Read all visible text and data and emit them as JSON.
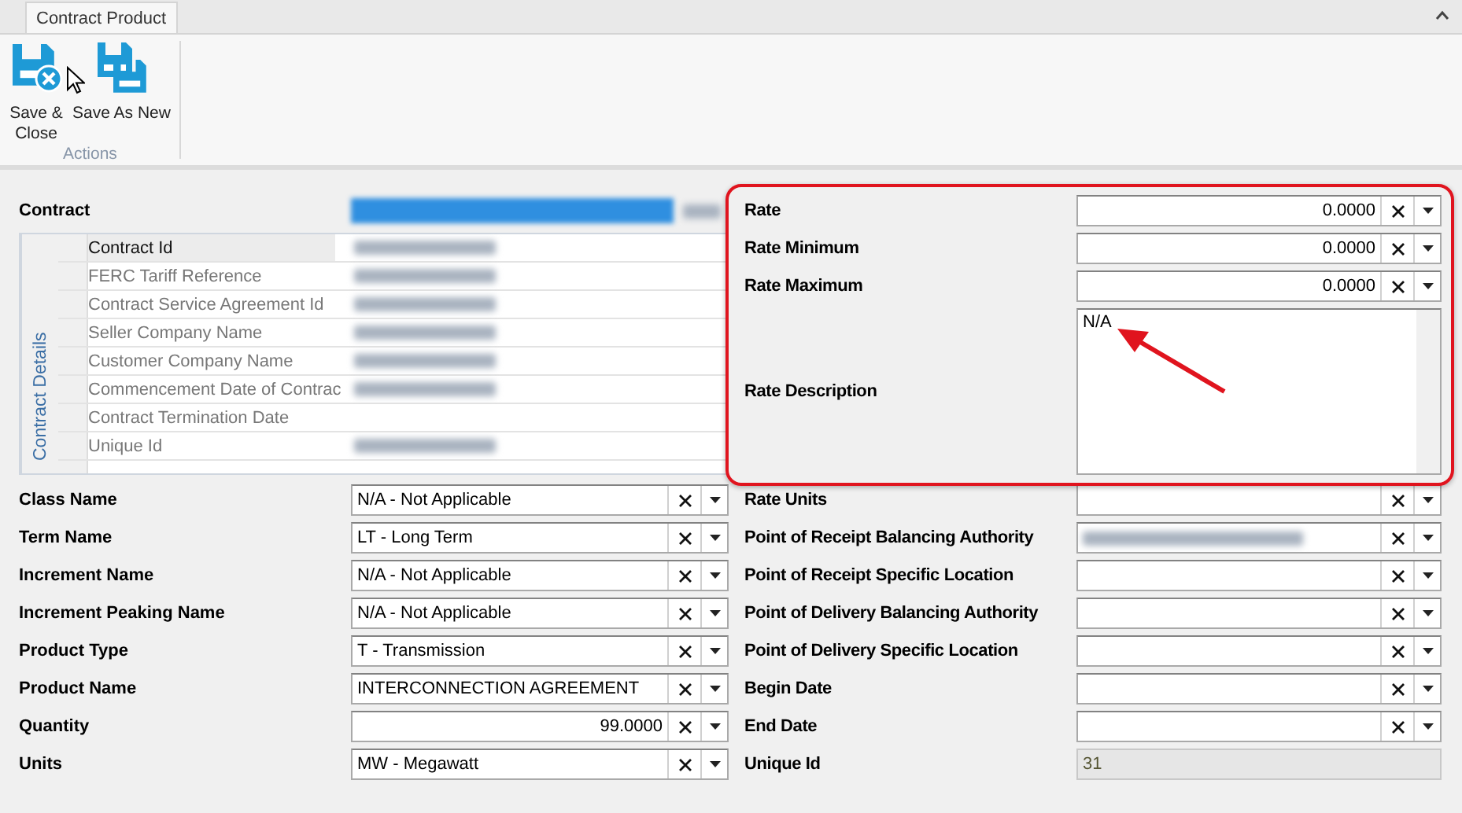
{
  "tabs": [
    {
      "label": "Contract Product",
      "selected": true
    }
  ],
  "ribbon": {
    "groups": [
      {
        "label": "Actions",
        "buttons": [
          {
            "kind": "save-close",
            "label": "Save &\nClose"
          },
          {
            "kind": "save-new",
            "label": "Save As New"
          }
        ]
      }
    ]
  },
  "contract": {
    "label": "Contract",
    "kind": "blurred-combo"
  },
  "contract_details": {
    "title": "Contract Details",
    "rows": [
      {
        "label": "Contract Id",
        "selected": true,
        "blurred": true
      },
      {
        "label": "FERC Tariff Reference",
        "selected": false,
        "blurred": true
      },
      {
        "label": "Contract Service Agreement Id",
        "selected": false,
        "blurred": true
      },
      {
        "label": "Seller Company Name",
        "selected": false,
        "blurred": true
      },
      {
        "label": "Customer Company Name",
        "selected": false,
        "blurred": true
      },
      {
        "label": "Commencement Date of Contrac",
        "selected": false,
        "blurred": true
      },
      {
        "label": "Contract Termination Date",
        "selected": false,
        "blurred": false
      },
      {
        "label": "Unique Id",
        "selected": false,
        "blurred": true
      }
    ]
  },
  "left_fields": [
    {
      "label": "Class Name",
      "kind": "combo",
      "value": "N/A - Not Applicable"
    },
    {
      "label": "Term Name",
      "kind": "combo",
      "value": "LT - Long Term"
    },
    {
      "label": "Increment Name",
      "kind": "combo",
      "value": "N/A - Not Applicable"
    },
    {
      "label": "Increment Peaking Name",
      "kind": "combo",
      "value": "N/A - Not Applicable"
    },
    {
      "label": "Product Type",
      "kind": "combo",
      "value": "T - Transmission"
    },
    {
      "label": "Product Name",
      "kind": "combo",
      "value": "INTERCONNECTION AGREEMENT"
    },
    {
      "label": "Quantity",
      "kind": "number",
      "value": "99.0000"
    },
    {
      "label": "Units",
      "kind": "combo",
      "value": "MW - Megawatt"
    }
  ],
  "rate_fields": [
    {
      "label": "Rate",
      "kind": "number",
      "value": "0.0000"
    },
    {
      "label": "Rate Minimum",
      "kind": "number",
      "value": "0.0000"
    },
    {
      "label": "Rate Maximum",
      "kind": "number",
      "value": "0.0000"
    },
    {
      "label": "Rate Description",
      "kind": "textarea",
      "value": "N/A"
    }
  ],
  "right_fields": [
    {
      "label": "Rate Units",
      "kind": "combo"
    },
    {
      "label": "Point of Receipt Balancing Authority",
      "kind": "blurred-combo"
    },
    {
      "label": "Point of Receipt Specific Location",
      "kind": "combo"
    },
    {
      "label": "Point of Delivery Balancing Authority",
      "kind": "combo"
    },
    {
      "label": "Point of Delivery Specific Location",
      "kind": "combo"
    },
    {
      "label": "Begin Date",
      "kind": "combo"
    },
    {
      "label": "End Date",
      "kind": "combo"
    },
    {
      "label": "Unique Id",
      "kind": "readonly",
      "value": "31"
    }
  ]
}
